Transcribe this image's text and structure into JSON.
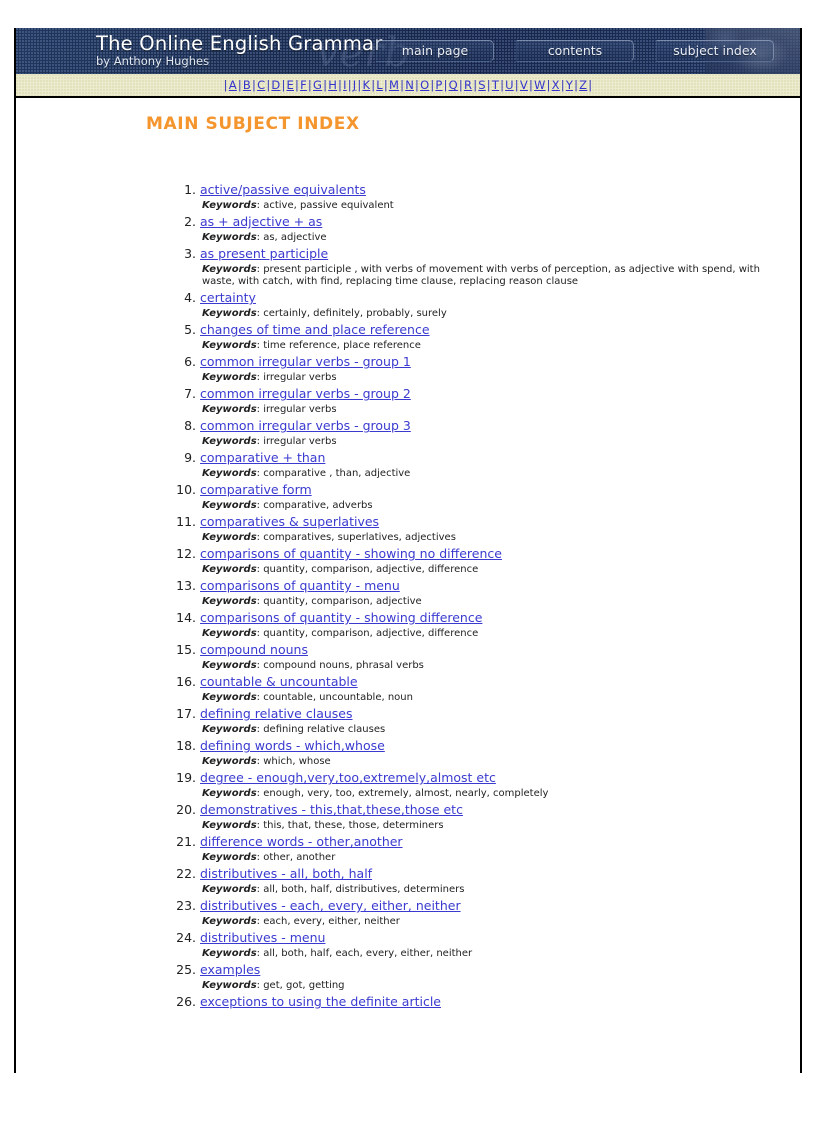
{
  "banner": {
    "title": "The Online English Grammar",
    "subtitle": "by Anthony Hughes",
    "ghost_text": "verb",
    "nav": [
      {
        "label": "main page",
        "name": "main-page"
      },
      {
        "label": "contents",
        "name": "contents"
      },
      {
        "label": "subject index",
        "name": "subject-index"
      }
    ]
  },
  "alphabet": {
    "separator": "|",
    "letters": [
      "A",
      "B",
      "C",
      "D",
      "E",
      "F",
      "G",
      "H",
      "I",
      "J",
      "K",
      "L",
      "M",
      "N",
      "O",
      "P",
      "Q",
      "R",
      "S",
      "T",
      "U",
      "V",
      "W",
      "X",
      "Y",
      "Z"
    ]
  },
  "page": {
    "title": "MAIN SUBJECT INDEX",
    "title_color": "#f4952e",
    "link_color": "#3333cc",
    "keywords_label": "Keywords"
  },
  "index_entries": [
    {
      "n": 1,
      "title": "active/passive equivalents",
      "keywords": "active, passive equivalent"
    },
    {
      "n": 2,
      "title": "as + adjective + as",
      "keywords": "as, adjective"
    },
    {
      "n": 3,
      "title": "as present participle",
      "keywords": "present participle , with verbs of movement with verbs of perception, as adjective with spend, with waste, with catch, with find, replacing time clause, replacing reason clause"
    },
    {
      "n": 4,
      "title": "certainty",
      "keywords": "certainly, definitely, probably, surely"
    },
    {
      "n": 5,
      "title": "changes of time and place reference",
      "keywords": "time reference, place reference"
    },
    {
      "n": 6,
      "title": "common irregular verbs - group 1",
      "keywords": "irregular verbs"
    },
    {
      "n": 7,
      "title": "common irregular verbs - group 2",
      "keywords": "irregular verbs"
    },
    {
      "n": 8,
      "title": "common irregular verbs - group 3",
      "keywords": "irregular verbs"
    },
    {
      "n": 9,
      "title": "comparative + than",
      "keywords": "comparative , than, adjective"
    },
    {
      "n": 10,
      "title": "comparative form",
      "keywords": "comparative, adverbs"
    },
    {
      "n": 11,
      "title": "comparatives & superlatives",
      "keywords": "comparatives, superlatives, adjectives"
    },
    {
      "n": 12,
      "title": "comparisons of quantity - showing no difference",
      "keywords": "quantity, comparison, adjective, difference"
    },
    {
      "n": 13,
      "title": "comparisons of quantity - menu",
      "keywords": "quantity, comparison, adjective"
    },
    {
      "n": 14,
      "title": "comparisons of quantity - showing difference",
      "keywords": "quantity, comparison, adjective, difference"
    },
    {
      "n": 15,
      "title": "compound nouns",
      "keywords": "compound nouns, phrasal verbs"
    },
    {
      "n": 16,
      "title": "countable & uncountable",
      "keywords": "countable, uncountable, noun"
    },
    {
      "n": 17,
      "title": "defining relative clauses",
      "keywords": "defining relative clauses"
    },
    {
      "n": 18,
      "title": "defining words - which,whose",
      "keywords": "which, whose"
    },
    {
      "n": 19,
      "title": "degree - enough,very,too,extremely,almost etc",
      "keywords": "enough, very, too, extremely, almost, nearly, completely"
    },
    {
      "n": 20,
      "title": "demonstratives - this,that,these,those etc",
      "keywords": "this, that, these, those, determiners"
    },
    {
      "n": 21,
      "title": "difference words - other,another",
      "keywords": "other, another"
    },
    {
      "n": 22,
      "title": "distributives - all, both, half",
      "keywords": "all, both, half, distributives, determiners"
    },
    {
      "n": 23,
      "title": "distributives - each, every, either, neither",
      "keywords": "each, every, either, neither"
    },
    {
      "n": 24,
      "title": "distributives - menu",
      "keywords": "all, both, half, each, every, either, neither"
    },
    {
      "n": 25,
      "title": "examples",
      "keywords": "get, got, getting"
    },
    {
      "n": 26,
      "title": "exceptions to using the definite article",
      "keywords": ""
    }
  ]
}
